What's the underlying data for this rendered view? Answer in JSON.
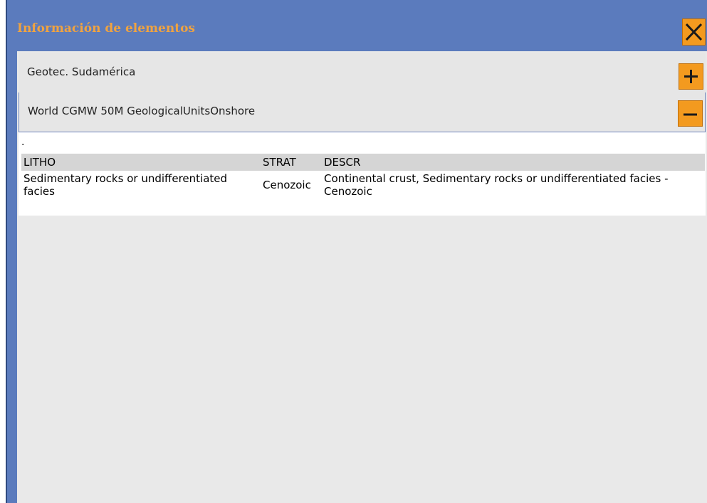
{
  "window": {
    "title": "Información de elementos"
  },
  "colors": {
    "title_bar": "#5b7bbd",
    "accent_orange": "#f39a1f",
    "title_text": "#f0a340",
    "panel_bg": "#e9e9e9",
    "table_header_bg": "#d5d5d5"
  },
  "icons": {
    "close": "close-icon",
    "expand": "plus-icon",
    "collapse": "minus-icon"
  },
  "layers": [
    {
      "name": "Geotec. Sudamérica",
      "state": "collapsed"
    },
    {
      "name": "World CGMW 50M GeologicalUnitsOnshore",
      "state": "expanded"
    }
  ],
  "feature": {
    "marker": ".",
    "columns": [
      "LITHO",
      "STRAT",
      "DESCR"
    ],
    "rows": [
      {
        "litho": "Sedimentary rocks or undifferentiated facies",
        "strat": "Cenozoic",
        "descr": "Continental crust, Sedimentary rocks or undifferentiated facies - Cenozoic"
      }
    ]
  }
}
